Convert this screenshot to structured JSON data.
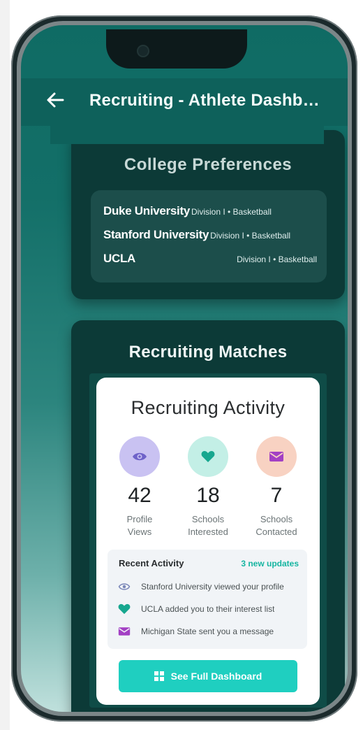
{
  "appbar": {
    "title": "Recruiting - Athlete Dashb…"
  },
  "college_preferences": {
    "heading": "College Preferences",
    "schools": [
      {
        "name": "Duke University",
        "meta": "Division I • Basketball"
      },
      {
        "name": "Stanford University",
        "meta": "Division I • Basketball"
      },
      {
        "name": "UCLA",
        "meta": "Division I • Basketball"
      }
    ]
  },
  "matches": {
    "title": "Recruiting Matches",
    "activity": {
      "title": "Recruiting Activity",
      "stats": [
        {
          "value": "42",
          "label_line1": "Profile",
          "label_line2": "Views",
          "icon": "eye-icon",
          "color": "#c9c2f2"
        },
        {
          "value": "18",
          "label_line1": "Schools",
          "label_line2": "Interested",
          "icon": "heart-icon",
          "color": "#c3efe6"
        },
        {
          "value": "7",
          "label_line1": "Schools",
          "label_line2": "Contacted",
          "icon": "mail-icon",
          "color": "#f8d2c2"
        }
      ],
      "recent": {
        "heading": "Recent Activity",
        "badge": "3 new updates",
        "items": [
          {
            "icon": "eye-icon",
            "text": "Stanford University viewed your profile"
          },
          {
            "icon": "heart-icon",
            "text": "UCLA added you to their interest list"
          },
          {
            "icon": "mail-icon",
            "text": "Michigan State sent you a message"
          }
        ]
      },
      "button_label": "See Full Dashboard"
    }
  },
  "colors": {
    "accent": "#1fcfc0",
    "card_dark": "#0c3a37",
    "appbar": "#0e615b"
  }
}
